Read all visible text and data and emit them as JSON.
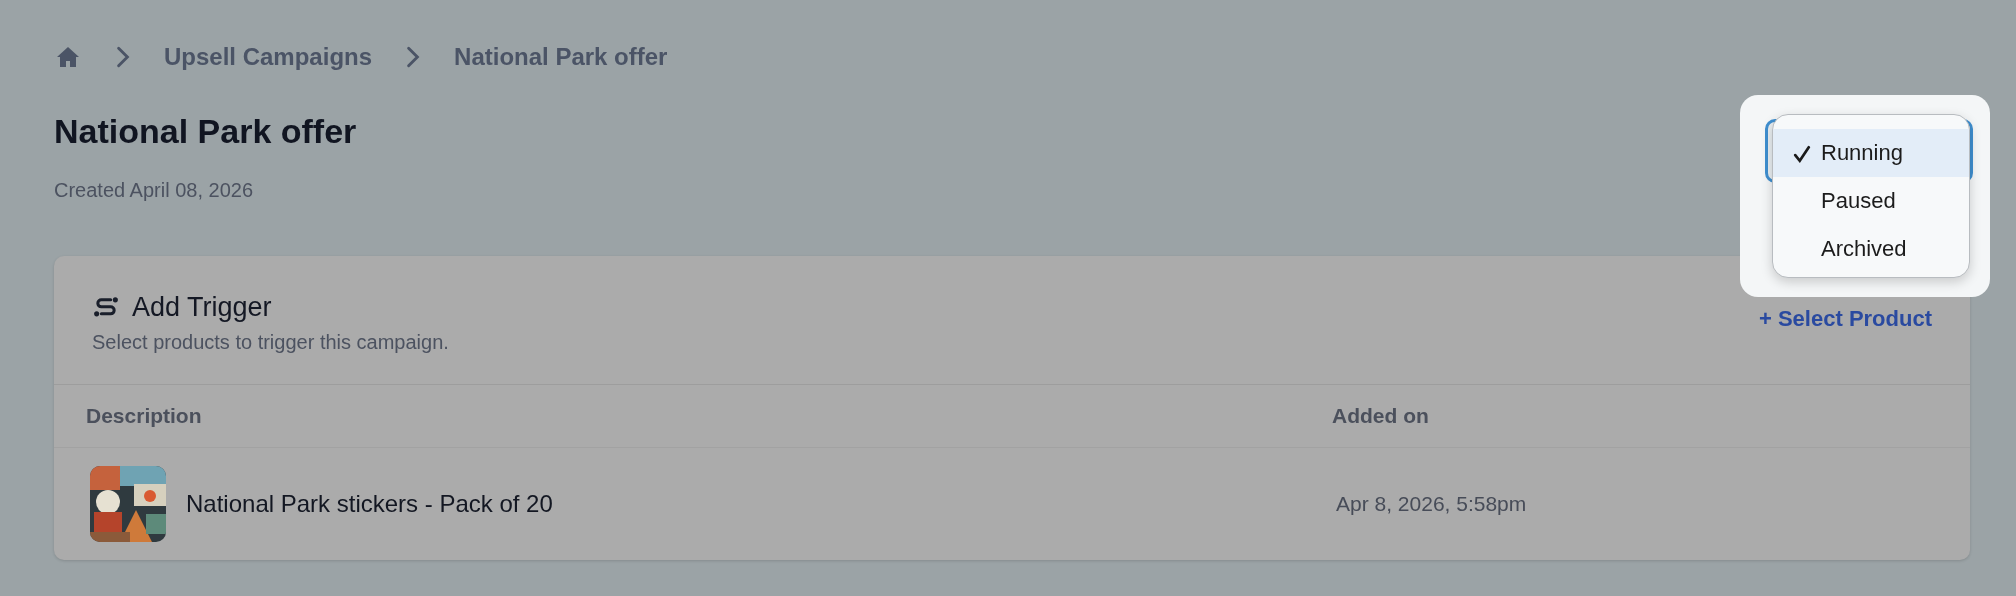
{
  "breadcrumb": {
    "items": [
      {
        "label": "Upsell Campaigns"
      },
      {
        "label": "National Park offer"
      }
    ]
  },
  "page": {
    "title": "National Park offer",
    "created": "Created April 08, 2026"
  },
  "status_menu": {
    "items": [
      {
        "label": "Running",
        "selected": true
      },
      {
        "label": "Paused",
        "selected": false
      },
      {
        "label": "Archived",
        "selected": false
      }
    ]
  },
  "trigger_card": {
    "title": "Add Trigger",
    "subtitle": "Select products to trigger this campaign.",
    "action": "+ Select Product",
    "table": {
      "columns": [
        "Description",
        "Added on"
      ],
      "rows": [
        {
          "description": "National Park stickers - Pack of 20",
          "added_on": "Apr 8, 2026, 5:58pm"
        }
      ]
    }
  }
}
